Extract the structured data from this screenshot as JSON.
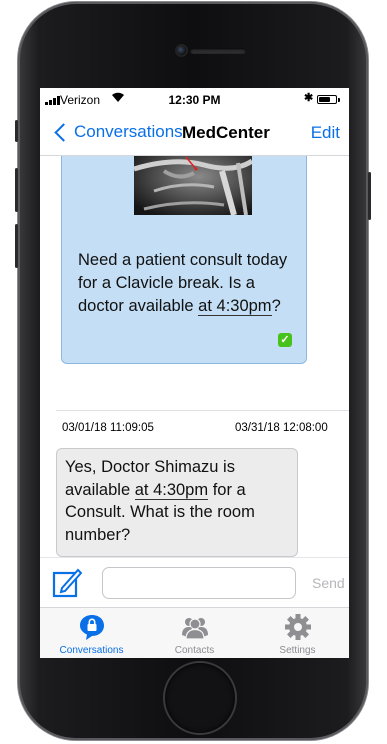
{
  "status_bar": {
    "carrier": "Verizon",
    "time": "12:30 PM",
    "battery_level": 0.7
  },
  "nav": {
    "back_label": "Conversations",
    "title": "MedCenter",
    "edit_label": "Edit"
  },
  "messages": {
    "sent": {
      "text_before": "Need a patient consult today for a Clavicle break. Is a doctor available ",
      "time_link": "at 4:30pm",
      "text_after": "?"
    },
    "received": {
      "sent_at": "03/01/18 11:09:05",
      "received_at": "03/31/18 12:08:00",
      "text_before": "Yes, Doctor Shimazu is available ",
      "time_link": "at 4:30pm",
      "text_after": " for a Consult. What is the room number?"
    }
  },
  "compose": {
    "input_value": "",
    "send_label": "Send"
  },
  "tabs": [
    {
      "label": "Conversations",
      "icon": "chat-bubble-lock-icon",
      "active": true
    },
    {
      "label": "Contacts",
      "icon": "people-icon",
      "active": false
    },
    {
      "label": "Settings",
      "icon": "gear-icon",
      "active": false
    }
  ],
  "colors": {
    "accent": "#0a70e8",
    "sent_bubble": "#c4dff5",
    "received_bubble": "#ececec",
    "delivered_check": "#47c21a"
  }
}
